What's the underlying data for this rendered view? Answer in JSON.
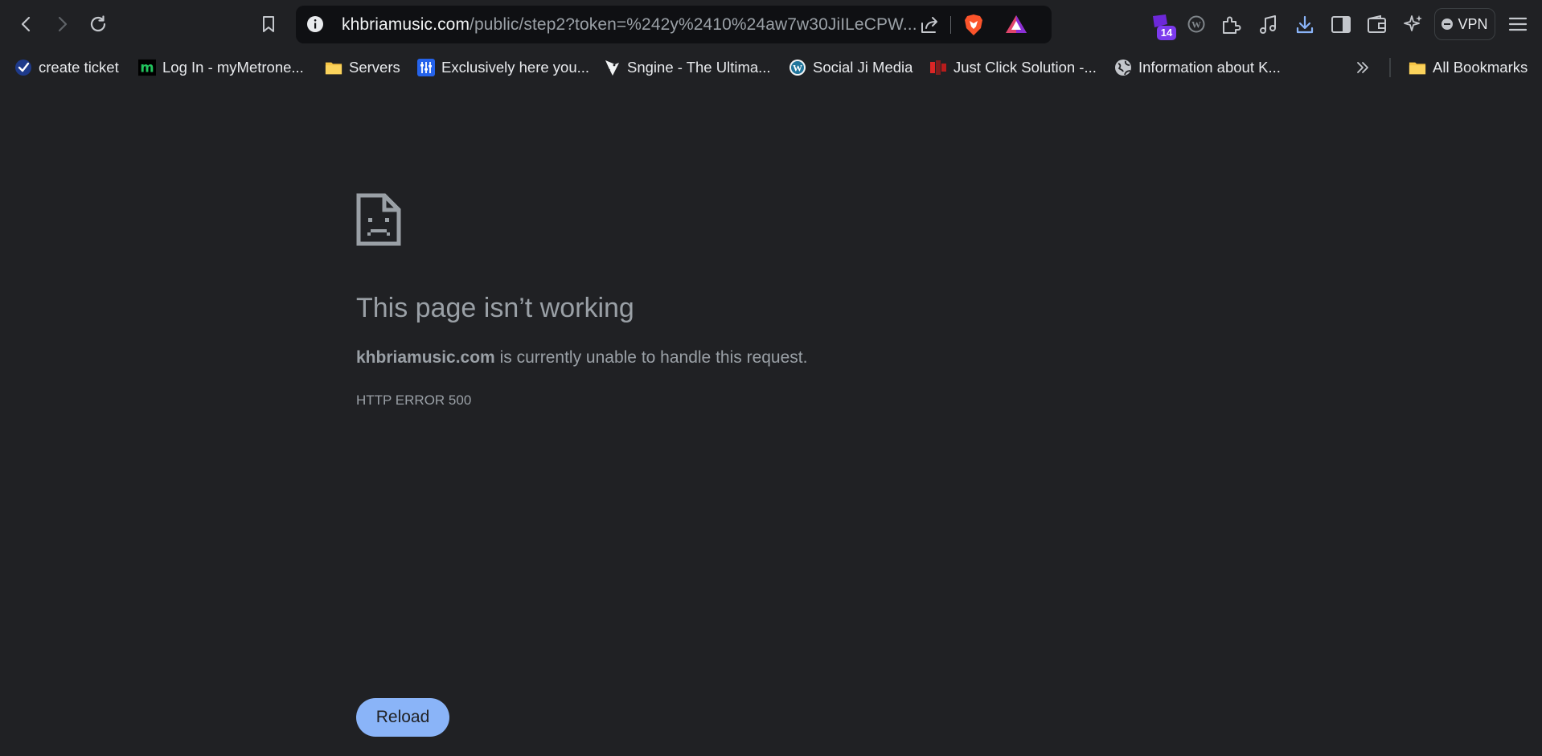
{
  "toolbar": {
    "url_host": "khbriamusic.com",
    "url_path": "/public/step2?token=%242y%2410%24aw7w30JiILeCPW...",
    "extension_badge_count": "14",
    "vpn_label": "VPN"
  },
  "bookmarks": [
    {
      "label": "create ticket",
      "icon": "checkmark-circle-icon"
    },
    {
      "label": "Log In - myMetrone...",
      "icon": "metronome-m-icon"
    },
    {
      "label": "Servers",
      "icon": "folder-icon"
    },
    {
      "label": "Exclusively here you...",
      "icon": "sliders-icon"
    },
    {
      "label": "Sngine - The Ultima...",
      "icon": "bird-icon"
    },
    {
      "label": "Social Ji Media",
      "icon": "wordpress-icon"
    },
    {
      "label": "Just Click Solution -...",
      "icon": "jcs-logo-icon"
    },
    {
      "label": "Information about K...",
      "icon": "globe-icon"
    }
  ],
  "all_bookmarks_label": "All Bookmarks",
  "error": {
    "title": "This page isn’t working",
    "host": "khbriamusic.com",
    "message": " is currently unable to handle this request.",
    "code": "HTTP ERROR 500",
    "reload_label": "Reload"
  },
  "colors": {
    "background": "#202124",
    "address_bar": "#0f1013",
    "reload_button": "#8ab4f8",
    "muted_text": "#9aa0a6",
    "badge": "#7c3aed"
  }
}
